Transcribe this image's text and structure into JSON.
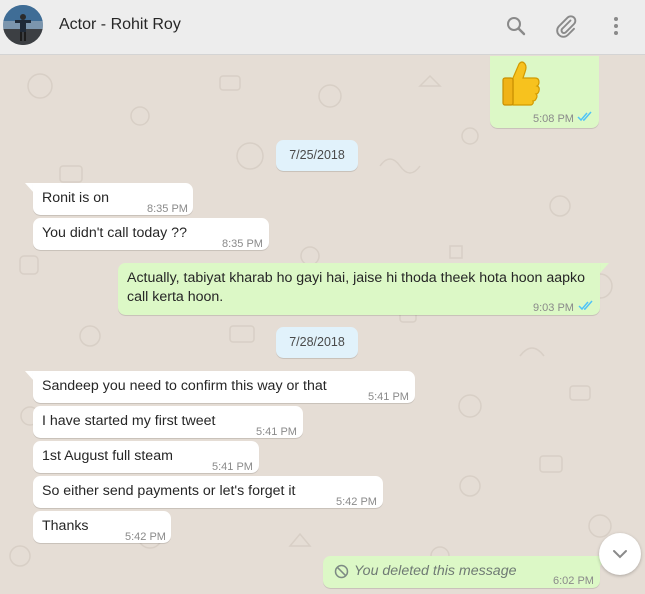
{
  "header": {
    "contact_name": "Actor - Rohit Roy",
    "icons": [
      "search-icon",
      "attach-icon",
      "menu-icon"
    ]
  },
  "colors": {
    "header_bg": "#ededed",
    "chat_bg": "#e5ddd5",
    "incoming_bubble": "#ffffff",
    "outgoing_bubble": "#dcf8c6",
    "date_chip": "#e1f2fb",
    "read_ticks": "#4fc3f7"
  },
  "messages": {
    "thumbs_time": "5:08 PM",
    "date1": "7/25/2018",
    "m1_text": "Ronit is on",
    "m1_time": "8:35 PM",
    "m2_text": "You didn't call today ??",
    "m2_time": "8:35 PM",
    "m3_line1": "Actually, tabiyat kharab ho gayi hai, jaise hi thoda theek hota hoon aapko",
    "m3_line2": "call kerta hoon.",
    "m3_time": "9:03 PM",
    "date2": "7/28/2018",
    "m4_text": "Sandeep you need to confirm this way or that",
    "m4_time": "5:41 PM",
    "m5_text": "I have started my first tweet",
    "m5_time": "5:41 PM",
    "m6_text": "1st August full steam",
    "m6_time": "5:41 PM",
    "m7_text": "So either send payments or let's forget it",
    "m7_time": "5:42 PM",
    "m8_text": "Thanks",
    "m8_time": "5:42 PM",
    "m9_text": "You deleted this message",
    "m9_time": "6:02 PM"
  }
}
